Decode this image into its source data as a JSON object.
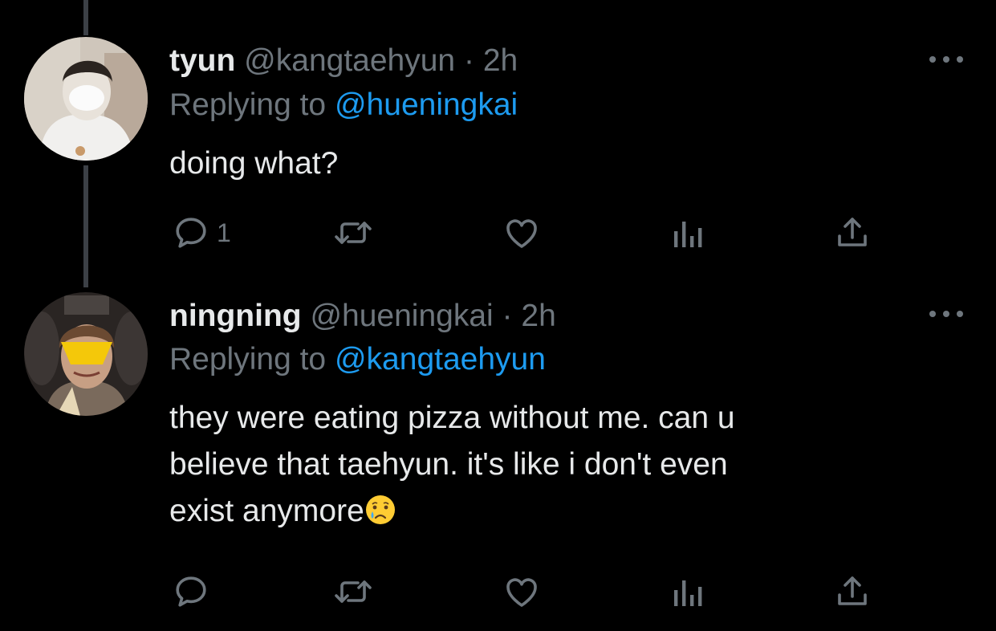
{
  "tweets": [
    {
      "display_name": "tyun",
      "handle": "@kangtaehyun",
      "separator": "·",
      "time": "2h",
      "replying_prefix": "Replying to",
      "replying_to": "@hueningkai",
      "text_lines": [
        "doing what?"
      ],
      "reply_count": "1"
    },
    {
      "display_name": "ningning",
      "handle": "@hueningkai",
      "separator": "·",
      "time": "2h",
      "replying_prefix": "Replying to",
      "replying_to": "@kangtaehyun",
      "text_lines": [
        "they were eating pizza without me. can u",
        "believe that taehyun. it's like i don't even",
        "exist anymore"
      ],
      "reply_count": ""
    }
  ],
  "icons": {
    "reply": "speech-bubble-icon",
    "retweet": "retweet-arrows-icon",
    "like": "heart-icon",
    "analytics": "bar-chart-icon",
    "share": "share-upload-icon",
    "more": "ellipsis-icon",
    "emoji": "crying-face-emoji"
  },
  "colors": {
    "background": "#000000",
    "text": "#e7e9ea",
    "muted": "#6e767d",
    "link": "#1d9bf0",
    "thread_line": "#3c4046"
  }
}
